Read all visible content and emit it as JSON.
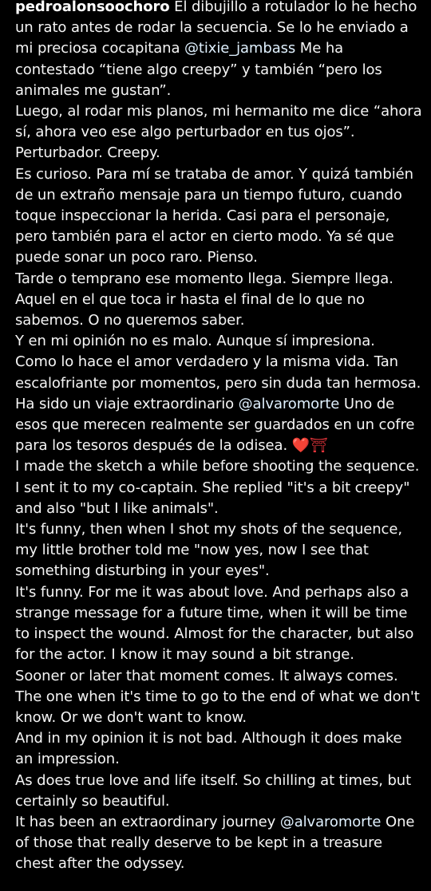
{
  "post": {
    "username": "pedroalonsoochoro",
    "paragraphs": [
      [
        {
          "t": "text",
          "v": " El dibujillo a rotulador lo he hecho un rato antes de rodar la secuencia. Se lo he enviado a mi preciosa cocapitana "
        },
        {
          "t": "mention",
          "v": "@tixie_jambass"
        },
        {
          "t": "text",
          "v": " Me ha contestado “tiene algo creepy” y también “pero los animales me gustan”."
        }
      ],
      [
        {
          "t": "text",
          "v": "Luego, al rodar mis planos, mi hermanito me dice “ahora sí, ahora veo ese algo perturbador en tus ojos”."
        }
      ],
      [
        {
          "t": "text",
          "v": "Perturbador. Creepy."
        }
      ],
      [
        {
          "t": "text",
          "v": "Es curioso. Para mí se trataba de amor. Y quizá también de un extraño mensaje para un tiempo futuro, cuando toque inspeccionar la herida. Casi para el personaje, pero también para el actor en cierto modo. Ya sé que puede sonar un poco raro. Pienso."
        }
      ],
      [
        {
          "t": "text",
          "v": "Tarde o temprano ese momento llega. Siempre llega. Aquel en el que toca ir hasta el final de lo que no sabemos. O no queremos saber."
        }
      ],
      [
        {
          "t": "text",
          "v": "Y en mi opinión no es malo. Aunque sí impresiona."
        }
      ],
      [
        {
          "t": "text",
          "v": "Como lo hace el amor verdadero y la misma vida. Tan escalofriante por momentos, pero sin duda tan hermosa."
        }
      ],
      [
        {
          "t": "text",
          "v": "Ha sido un viaje extraordinario "
        },
        {
          "t": "mention",
          "v": "@alvaromorte"
        },
        {
          "t": "text",
          "v": " Uno de esos que merecen realmente ser guardados en un cofre para los tesoros después de la odisea. "
        },
        {
          "t": "emoji-heart",
          "v": "❤️"
        },
        {
          "t": "emoji-torii",
          "v": "⛩"
        }
      ],
      [
        {
          "t": "text",
          "v": "I made the sketch a while before shooting the sequence. I sent it to my co-captain. She replied \"it's a bit creepy\" and also \"but I like animals\"."
        }
      ],
      [
        {
          "t": "text",
          "v": "It's funny, then when I shot my shots of the sequence, my little brother told me \"now yes, now I see that something disturbing in your eyes\"."
        }
      ],
      [
        {
          "t": "text",
          "v": "It's funny. For me it was about love. And perhaps also a strange message for a future time, when it will be time to inspect the wound. Almost for the character, but also for the actor. I know it may sound a bit strange."
        }
      ],
      [
        {
          "t": "text",
          "v": "Sooner or later that moment comes. It always comes. The one when it's time to go to the end of what we don't know. Or we don't want to know."
        }
      ],
      [
        {
          "t": "text",
          "v": "And in my opinion it is not bad. Although it does make an impression."
        }
      ],
      [
        {
          "t": "text",
          "v": "As does true love and life itself. So chilling at times, but certainly so beautiful."
        }
      ],
      [
        {
          "t": "text",
          "v": "It has been an extraordinary journey "
        },
        {
          "t": "mention",
          "v": "@alvaromorte"
        },
        {
          "t": "text",
          "v": " One of those that really deserve to be kept in a treasure chest after the odyssey."
        }
      ]
    ]
  },
  "colors": {
    "background": "#000000",
    "text": "#f5f5f5",
    "mention": "#e0f1ff",
    "heart": "#e8232e"
  }
}
